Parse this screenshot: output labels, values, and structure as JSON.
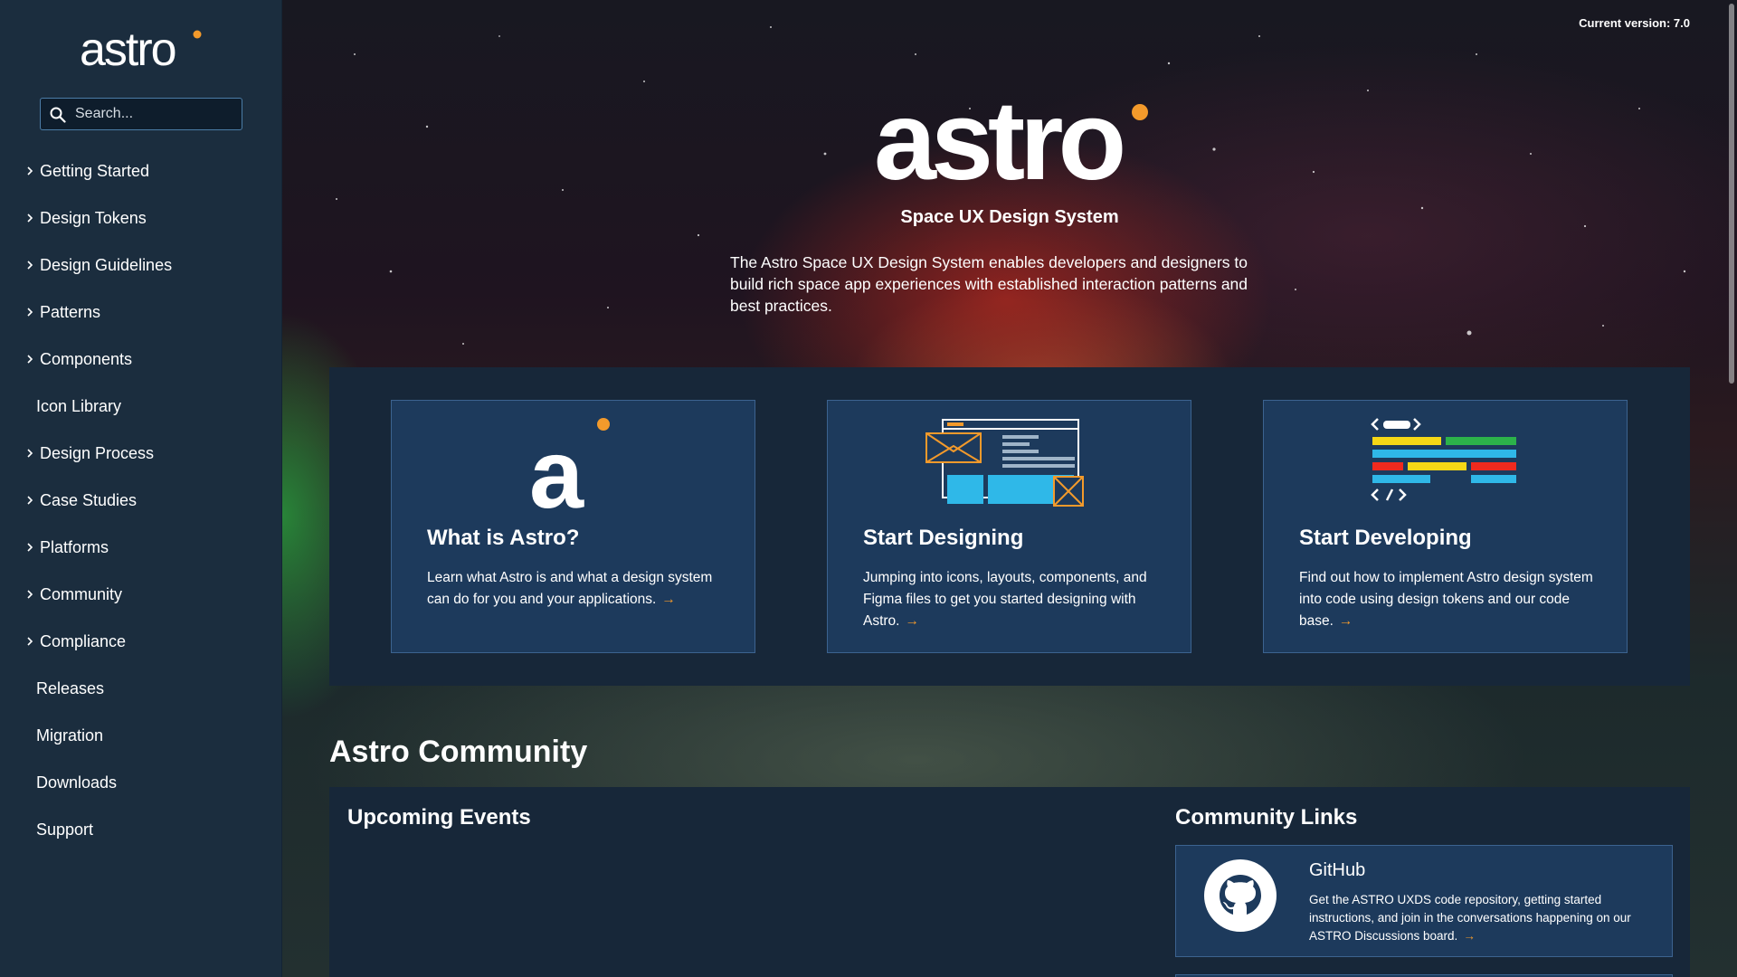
{
  "sidebar": {
    "logo_text": "astro",
    "search": {
      "placeholder": "Search..."
    },
    "items": [
      {
        "label": "Getting Started",
        "expandable": true
      },
      {
        "label": "Design Tokens",
        "expandable": true
      },
      {
        "label": "Design Guidelines",
        "expandable": true
      },
      {
        "label": "Patterns",
        "expandable": true
      },
      {
        "label": "Components",
        "expandable": true
      },
      {
        "label": "Icon Library",
        "expandable": false
      },
      {
        "label": "Design Process",
        "expandable": true
      },
      {
        "label": "Case Studies",
        "expandable": true
      },
      {
        "label": "Platforms",
        "expandable": true
      },
      {
        "label": "Community",
        "expandable": true
      },
      {
        "label": "Compliance",
        "expandable": true
      },
      {
        "label": "Releases",
        "expandable": false
      },
      {
        "label": "Migration",
        "expandable": false
      },
      {
        "label": "Downloads",
        "expandable": false
      },
      {
        "label": "Support",
        "expandable": false
      }
    ]
  },
  "header": {
    "version": "Current version: 7.0",
    "logo_text": "astro",
    "tagline": "Space UX Design System",
    "intro": "The Astro Space UX Design System enables developers and designers to build rich space app experiences with established interaction patterns and best practices."
  },
  "cards": [
    {
      "title": "What is Astro?",
      "description": "Learn what Astro is and what a design system can do for you and your applications.",
      "icon": "astro-a-icon"
    },
    {
      "title": "Start Designing",
      "description": "Jumping into icons, layouts, components, and Figma files to get you started designing with Astro.",
      "icon": "layout-design-icon"
    },
    {
      "title": "Start Developing",
      "description": "Find out how to implement Astro design system into code using design tokens and our code base.",
      "icon": "code-icon"
    }
  ],
  "community": {
    "heading": "Astro Community",
    "events_heading": "Upcoming Events",
    "links_heading": "Community Links",
    "github": {
      "title": "GitHub",
      "description": "Get the ASTRO UXDS code repository, getting started instructions, and join in the conversations happening on our ASTRO Discussions board."
    }
  },
  "colors": {
    "sidebar_bg": "#1b2d3e",
    "card_bg": "#1d3a5c",
    "accent_orange": "#f39a2b",
    "panel_bg": "#172739"
  }
}
